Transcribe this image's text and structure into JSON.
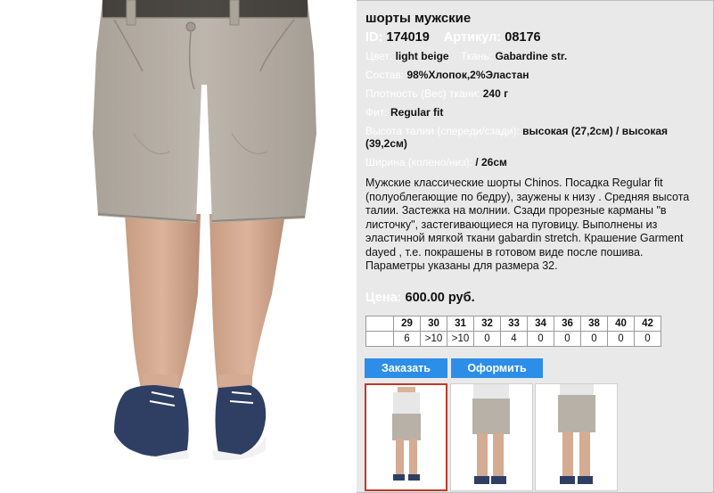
{
  "product": {
    "title": "шорты мужские",
    "id_label": "ID:",
    "id_value": "174019",
    "article_label": "Артикул:",
    "article_value": "08176",
    "color_label": "Цвет:",
    "color_value": "light beige",
    "fabric_label": "Ткань:",
    "fabric_value": "Gabardine str.",
    "composition_label": "Состав:",
    "composition_value": "98%Хлопок,2%Эластан",
    "density_label": "Плотность (Вес) ткани:",
    "density_value": "240 г",
    "fit_label": "Фит:",
    "fit_value": "Regular fit",
    "waist_label": "Высота талии (спереди/сзади):",
    "waist_value": "высокая (27,2см) / высокая (39,2см)",
    "width_label": "Ширина (колено/низ):",
    "width_value": "/ 26см",
    "description": "Мужские классические шорты Chinos. Посадка Regular fit (полуоблегающие по бедру), заужены к низу . Средняя высота  талии. Застежка на молнии. Сзади  прорезные карманы  \"в листочку\", застегивающиеся на  пуговицу. Выполнены из эластичной мягкой ткани gabardin stretch. Крашение Garment dayed , т.е. покрашены  в  готовом виде после пошива. Параметры указаны для размера 32.",
    "price_label": "Цена:",
    "price_value": "600.00 руб."
  },
  "sizes": {
    "headers": [
      "29",
      "30",
      "31",
      "32",
      "33",
      "34",
      "36",
      "38",
      "40",
      "42"
    ],
    "stock": [
      "6",
      ">10",
      ">10",
      "0",
      "4",
      "0",
      "0",
      "0",
      "0",
      "0"
    ]
  },
  "buttons": {
    "order_label": "Заказать",
    "checkout_label": "Оформить"
  },
  "colors": {
    "accent": "#2c8ee8",
    "short_fabric": "#b8b1a7",
    "shoe": "#2f3e63",
    "selected_border": "#c0392b"
  }
}
